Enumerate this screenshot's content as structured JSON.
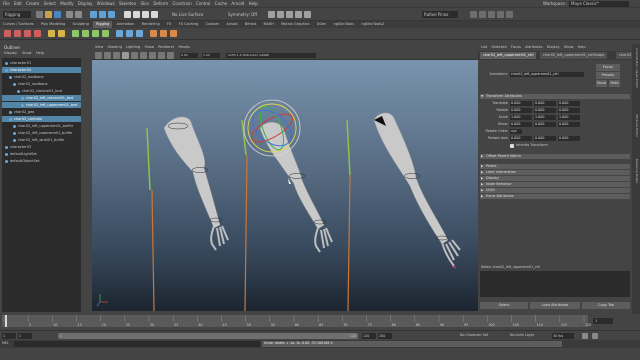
{
  "menubar": {
    "items": [
      "File",
      "Edit",
      "Create",
      "Select",
      "Modify",
      "Display",
      "Windows",
      "Skeleton",
      "Skin",
      "Deform",
      "Constrain",
      "Control",
      "Cache",
      "Arnold",
      "Help"
    ],
    "workspace_label": "Workspace :",
    "workspace_value": "Maya Classic*"
  },
  "statusline": {
    "mode": "Rigging",
    "live_surface": "No Live Surface",
    "symmetry": "Symmetry: Off",
    "sign_in": "Rafael Pinez"
  },
  "shelf_tabs": [
    "Curves / Surfaces",
    "Poly Modeling",
    "Sculpting",
    "Rigging",
    "Animation",
    "Rendering",
    "FX",
    "FX Caching",
    "Custom",
    "Arnold",
    "Bifrost",
    "MASH",
    "Motion Graphics",
    "XGen",
    "ngSkinTools",
    "ngSkinTools2"
  ],
  "shelf_active_tab": "Rigging",
  "outliner": {
    "title": "Outliner",
    "menu": [
      "Display",
      "Show",
      "Help"
    ],
    "items": [
      {
        "label": "character01",
        "indent": 0,
        "selected": false
      },
      {
        "label": "character02",
        "indent": 0,
        "selected": true
      },
      {
        "label": "char02_rootbone",
        "indent": 1,
        "selected": false
      },
      {
        "label": "char02_rootbone",
        "indent": 2,
        "selected": false
      },
      {
        "label": "char02_clavicle01_bnd",
        "indent": 3,
        "selected": false
      },
      {
        "label": "char02_left_clavicle01_bnd",
        "indent": 4,
        "selected": true
      },
      {
        "label": "char02_left_upperarm01_bnd",
        "indent": 4,
        "selected": true
      },
      {
        "label": "char02_geo",
        "indent": 1,
        "selected": false
      },
      {
        "label": "char02_controls",
        "indent": 1,
        "selected": true
      },
      {
        "label": "char02_left_upperarm01_buffer",
        "indent": 2,
        "selected": false
      },
      {
        "label": "char02_left_lowerarm01_buffer",
        "indent": 2,
        "selected": false
      },
      {
        "label": "char02_left_wrist01_buffer",
        "indent": 2,
        "selected": false
      },
      {
        "label": "character03",
        "indent": 0,
        "selected": false
      },
      {
        "label": "defaultLightSet",
        "indent": 0,
        "selected": false
      },
      {
        "label": "defaultObjectSet",
        "indent": 0,
        "selected": false
      }
    ]
  },
  "viewport": {
    "menu": [
      "View",
      "Shading",
      "Lighting",
      "Show",
      "Renderer",
      "Panels"
    ],
    "colorspace": "ACES 1.0 SDR-video (sRGB)",
    "exposure": "0.00",
    "gamma": "1.00"
  },
  "attribute_editor": {
    "menu": [
      "List",
      "Selected",
      "Focus",
      "Attributes",
      "Display",
      "Show",
      "Help"
    ],
    "tabs": [
      "char02_left_upperarm01_ctrl",
      "char02_left_upperarm01_ctrlShape",
      "char02"
    ],
    "transform_label": "transform:",
    "transform_value": "char02_left_upperarm01_ctrl",
    "buttons": {
      "focus": "Focus",
      "presets": "Presets",
      "show": "Show",
      "hide": "Hide"
    },
    "section_transform": "Transform Attributes",
    "attrs": [
      {
        "label": "Translate",
        "values": [
          "0.000",
          "0.000",
          "0.000"
        ]
      },
      {
        "label": "Rotate",
        "values": [
          "0.000",
          "0.000",
          "0.000"
        ]
      },
      {
        "label": "Scale",
        "values": [
          "1.000",
          "1.000",
          "1.000"
        ]
      },
      {
        "label": "Shear",
        "values": [
          "0.000",
          "0.000",
          "0.000"
        ]
      }
    ],
    "rotate_order_label": "Rotate Order",
    "rotate_order_value": "xyz",
    "rotate_axis_label": "Rotate Axis",
    "rotate_axis_values": [
      "0.000",
      "0.000",
      "0.000"
    ],
    "inherits_transform": "Inherits Transform",
    "sections": [
      "Offset Parent Matrix",
      "Pivots",
      "Limit Information",
      "Display",
      "Node Behavior",
      "UUID",
      "Extra Attributes"
    ],
    "notes_label": "Notes: char02_left_upperarm01_ctrl",
    "bottom_buttons": {
      "select": "Select",
      "load": "Load Attributes",
      "copy": "Copy Tab"
    }
  },
  "side_tabs": [
    "Channel Box / Layer Editor",
    "Attribute Editor",
    "Modeling Toolkit"
  ],
  "timeslider": {
    "ticks": [
      "0",
      "5",
      "10",
      "15",
      "20",
      "25",
      "30",
      "35",
      "40",
      "45",
      "50",
      "55",
      "60",
      "65",
      "70",
      "75",
      "80",
      "85",
      "90",
      "95",
      "100",
      "105",
      "110",
      "115",
      "120"
    ],
    "current_frame": "1"
  },
  "rangeslider": {
    "start": "1",
    "inner_start": "1",
    "inner_end": "120",
    "end_a": "120",
    "end_b": "200",
    "character_set": "No Character Set",
    "anim_layer": "No Anim Layer",
    "fps": "30 fps"
  },
  "cmdline": {
    "lang": "MEL",
    "result": "Undo: rotate -r -os -fo -0.00 -33.308169 0"
  },
  "helpline": "",
  "colors": {
    "selection": "#5285a6",
    "panel": "#444444",
    "field": "#2b2b2b",
    "accent": "#68a7d8"
  }
}
